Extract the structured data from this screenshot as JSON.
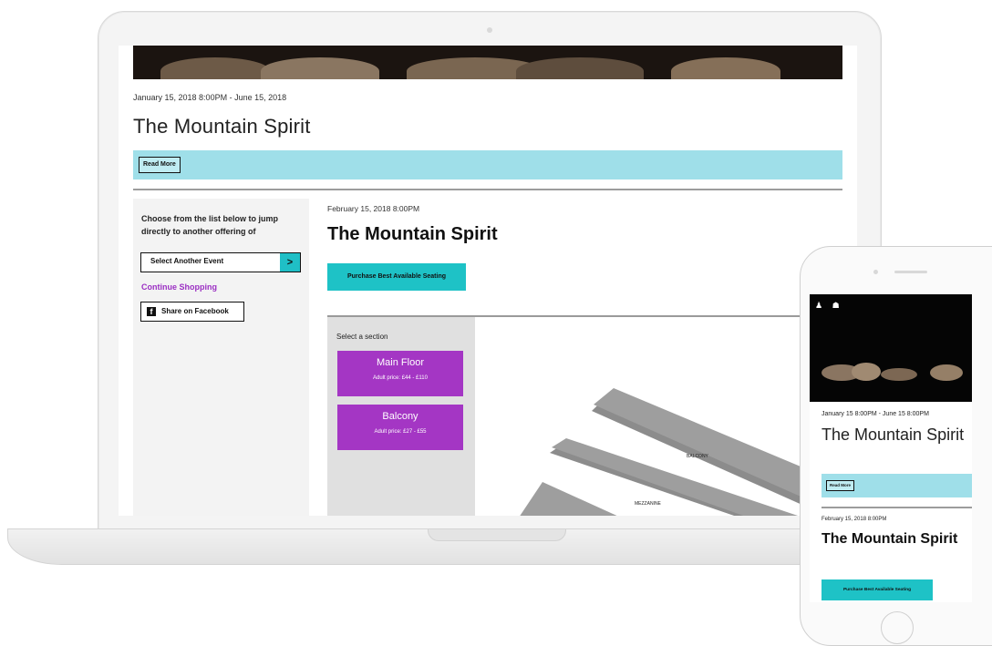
{
  "event": {
    "date_range": "January 15, 2018 8:00PM - June 15, 2018",
    "title": "The Mountain Spirit",
    "read_more": "Read More"
  },
  "sidebar": {
    "intro": "Choose from the list below to jump directly to another offering of",
    "select_event": "Select Another Event",
    "go_arrow": ">",
    "continue_shopping": "Continue Shopping",
    "share_facebook": "Share on Facebook",
    "facebook_icon": "f"
  },
  "performance": {
    "date": "February 15, 2018 8:00PM",
    "title": "The Mountain Spirit",
    "purchase_label": "Purchase Best Available Seating"
  },
  "seating": {
    "select_label": "Select a section",
    "sections": [
      {
        "name": "Main Floor",
        "price": "Adult price: £44 - £110"
      },
      {
        "name": "Balcony",
        "price": "Adult price: £27 - £55"
      }
    ],
    "map_labels": {
      "balcony": "BALCONY",
      "mezzanine": "MEZZANINE"
    }
  },
  "phone": {
    "date_range": "January 15 8:00PM - June 15 8:00PM",
    "title": "The Mountain Spirit",
    "read_more": "Read More",
    "perf_date": "February 15, 2018 8:00PM",
    "perf_title": "The Mountain Spirit",
    "purchase_label": "Purchase Best Available Seating",
    "icons": "♟ ☗"
  },
  "colors": {
    "teal_bar": "#9fdfe9",
    "teal_button": "#1ec2c6",
    "purple": "#a436c4",
    "link_purple": "#9b2fc3"
  }
}
